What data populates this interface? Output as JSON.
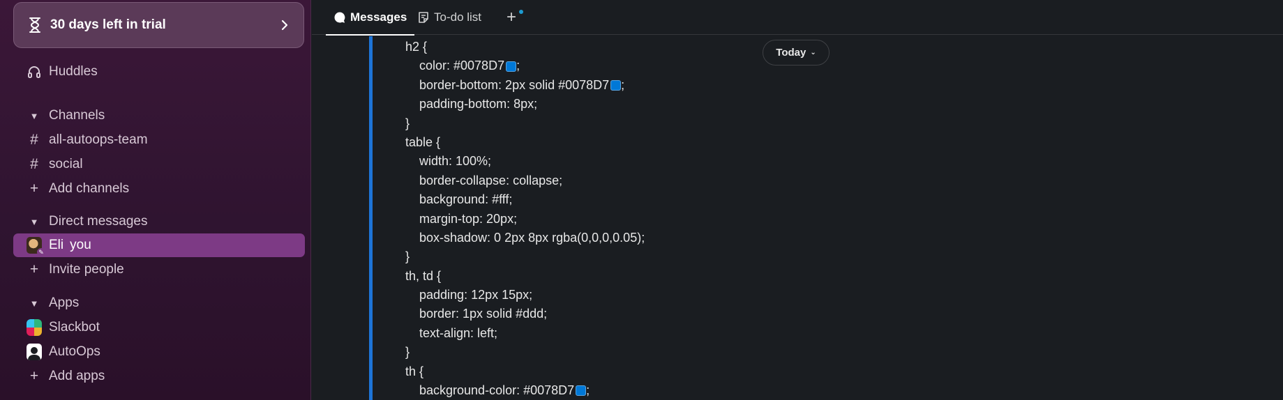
{
  "sidebar": {
    "trial_banner": "30 days left in trial",
    "huddles": "Huddles",
    "channels_header": "Channels",
    "channels": [
      "all-autoops-team",
      "social"
    ],
    "add_channels": "Add channels",
    "dm_header": "Direct messages",
    "dm_user": "Eli",
    "dm_you": "you",
    "invite_people": "Invite people",
    "apps_header": "Apps",
    "apps": [
      "Slackbot",
      "AutoOps"
    ],
    "add_apps": "Add apps",
    "active_color": "#7d3a85"
  },
  "tabs": {
    "messages": "Messages",
    "todo": "To-do list"
  },
  "date_pill": "Today",
  "code": {
    "lines": [
      {
        "text": "h2 {",
        "indent": false
      },
      {
        "text": "color: #0078D7",
        "indent": true,
        "swatch": true,
        "suffix": ";"
      },
      {
        "text": "border-bottom: 2px solid #0078D7",
        "indent": true,
        "swatch": true,
        "suffix": ";"
      },
      {
        "text": "padding-bottom: 8px;",
        "indent": true
      },
      {
        "text": "}",
        "indent": false
      },
      {
        "text": "table {",
        "indent": false
      },
      {
        "text": "width: 100%;",
        "indent": true
      },
      {
        "text": "border-collapse: collapse;",
        "indent": true
      },
      {
        "text": "background: #fff;",
        "indent": true
      },
      {
        "text": "margin-top: 20px;",
        "indent": true
      },
      {
        "text": "box-shadow: 0 2px 8px rgba(0,0,0,0.05);",
        "indent": true
      },
      {
        "text": "}",
        "indent": false
      },
      {
        "text": "th, td {",
        "indent": false
      },
      {
        "text": "padding: 12px 15px;",
        "indent": true
      },
      {
        "text": "border: 1px solid #ddd;",
        "indent": true
      },
      {
        "text": "text-align: left;",
        "indent": true
      },
      {
        "text": "}",
        "indent": false
      },
      {
        "text": "th {",
        "indent": false
      },
      {
        "text": "background-color: #0078D7",
        "indent": true,
        "swatch": true,
        "suffix": ";"
      }
    ],
    "quote_color": "#1d74d7",
    "swatch_color": "#0078D7"
  }
}
